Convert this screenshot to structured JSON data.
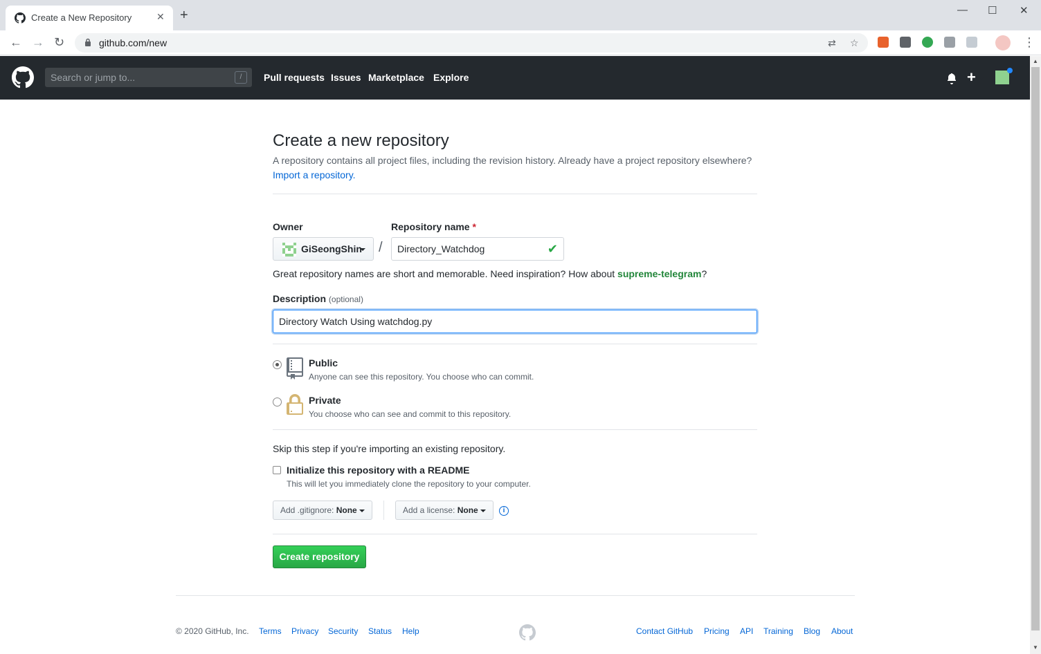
{
  "browser": {
    "tab_title": "Create a New Repository",
    "url": "github.com/new"
  },
  "header": {
    "search_placeholder": "Search or jump to...",
    "search_shortcut": "/",
    "nav": [
      "Pull requests",
      "Issues",
      "Marketplace",
      "Explore"
    ]
  },
  "form": {
    "title": "Create a new repository",
    "subtitle": "A repository contains all project files, including the revision history. Already have a project repository elsewhere?",
    "import_link": "Import a repository.",
    "owner_label": "Owner",
    "owner_value": "GiSeongShin",
    "separator": "/",
    "repo_label": "Repository name",
    "required_mark": "*",
    "repo_value": "Directory_Watchdog",
    "hint_prefix": "Great repository names are short and memorable. Need inspiration? How about",
    "hint_suggestion": "supreme-telegram",
    "hint_suffix": "?",
    "description_label": "Description",
    "description_optional": "(optional)",
    "description_value": "Directory Watch Using watchdog.py",
    "visibility": {
      "public_title": "Public",
      "public_desc": "Anyone can see this repository. You choose who can commit.",
      "private_title": "Private",
      "private_desc": "You choose who can see and commit to this repository.",
      "selected": "public"
    },
    "skip_text": "Skip this step if you're importing an existing repository.",
    "readme_title": "Initialize this repository with a README",
    "readme_desc": "This will let you immediately clone the repository to your computer.",
    "gitignore_label": "Add .gitignore:",
    "gitignore_value": "None",
    "license_label": "Add a license:",
    "license_value": "None",
    "info_glyph": "i",
    "create_button": "Create repository"
  },
  "footer": {
    "copyright": "© 2020 GitHub, Inc.",
    "left_links": [
      "Terms",
      "Privacy",
      "Security",
      "Status",
      "Help"
    ],
    "right_links": [
      "Contact GitHub",
      "Pricing",
      "API",
      "Training",
      "Blog",
      "About"
    ]
  },
  "colors": {
    "header_bg": "#24292e",
    "link": "#0366d6",
    "create_green": "#28a745",
    "check_green": "#28a745"
  }
}
